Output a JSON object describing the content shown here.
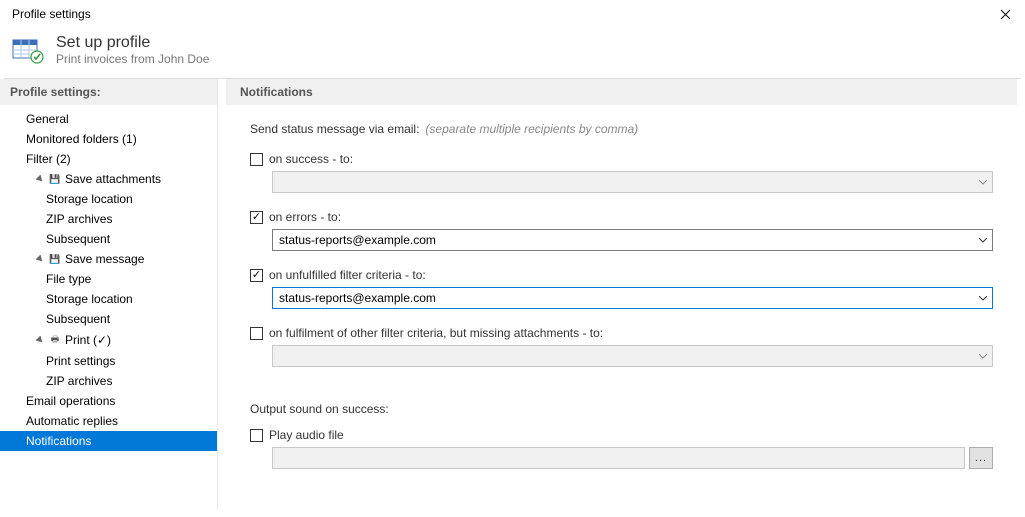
{
  "window": {
    "title": "Profile settings"
  },
  "header": {
    "title": "Set up profile",
    "subtitle": "Print invoices from John Doe"
  },
  "sidebar": {
    "heading": "Profile settings:",
    "items": [
      {
        "label": "General",
        "depth": 0
      },
      {
        "label": "Monitored folders (1)",
        "depth": 0
      },
      {
        "label": "Filter (2)",
        "depth": 0
      },
      {
        "label": "Save attachments",
        "depth": 1,
        "expander": true,
        "icon": "disk"
      },
      {
        "label": "Storage location",
        "depth": 2
      },
      {
        "label": "ZIP archives",
        "depth": 2
      },
      {
        "label": "Subsequent",
        "depth": 2
      },
      {
        "label": "Save message",
        "depth": 1,
        "expander": true,
        "icon": "disk"
      },
      {
        "label": "File type",
        "depth": 2
      },
      {
        "label": "Storage location",
        "depth": 2
      },
      {
        "label": "Subsequent",
        "depth": 2
      },
      {
        "label": "Print  (✓)",
        "depth": 1,
        "expander": true,
        "icon": "printer"
      },
      {
        "label": "Print settings",
        "depth": 2
      },
      {
        "label": "ZIP archives",
        "depth": 2
      },
      {
        "label": "Email operations",
        "depth": 0
      },
      {
        "label": "Automatic replies",
        "depth": 0
      },
      {
        "label": "Notifications",
        "depth": 0,
        "selected": true
      }
    ]
  },
  "panel": {
    "heading": "Notifications",
    "sendStatusLabel": "Send status message via email:",
    "sendStatusHint": "(separate multiple recipients by comma)",
    "fields": {
      "success": {
        "label": "on success - to:",
        "checked": false,
        "value": "",
        "disabled": true
      },
      "errors": {
        "label": "on errors - to:",
        "checked": true,
        "value": "status-reports@example.com",
        "disabled": false
      },
      "unfulfilled": {
        "label": "on unfulfilled filter criteria - to:",
        "checked": true,
        "value": "status-reports@example.com",
        "disabled": false,
        "focused": true
      },
      "missing": {
        "label": "on fulfilment of other filter criteria, but missing attachments - to:",
        "checked": false,
        "value": "",
        "disabled": true
      }
    },
    "soundHeading": "Output sound on success:",
    "playAudio": {
      "label": "Play audio file",
      "checked": false,
      "value": "",
      "disabled": true
    },
    "browseLabel": "..."
  }
}
